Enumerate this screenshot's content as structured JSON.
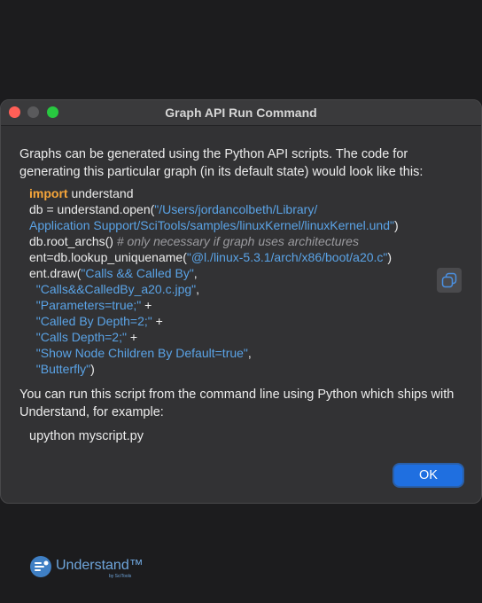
{
  "window": {
    "title": "Graph API Run Command"
  },
  "intro": "Graphs can be generated using the Python API scripts. The code for generating this particular graph (in its default state) would look like this:",
  "code": {
    "line1_kw": "import",
    "line1_rest": " understand",
    "line2_pre": "db = understand.open(",
    "line2_str": "\"/Users/jordancolbeth/Library/",
    "line3_str": "Application Support/SciTools/samples/linuxKernel/linuxKernel.und\"",
    "line3_post": ")",
    "line4_pre": "db.root_archs() ",
    "line4_comment": "# only necessary if graph uses architectures",
    "line5_pre": "ent=db.lookup_uniquename(",
    "line5_str": "\"@l./linux-5.3.1/arch/x86/boot/a20.c\"",
    "line5_post": ")",
    "line6_pre": "ent.draw(",
    "line6_str": "\"Calls && Called By\"",
    "line6_post": ",",
    "line7_str": "\"Calls&&CalledBy_a20.c.jpg\"",
    "line7_post": ",",
    "line8_str": "\"Parameters=true;\"",
    "line8_post": " +",
    "line9_str": "\"Called By Depth=2;\"",
    "line9_post": " +",
    "line10_str": "\"Calls Depth=2;\"",
    "line10_post": " +",
    "line11_str": "\"Show Node Children By Default=true\"",
    "line11_post": ",",
    "line12_str": "\"Butterfly\"",
    "line12_post": ")"
  },
  "outro": "You can run this script from the command line using Python which ships with Understand, for example:",
  "command": "upython myscript.py",
  "buttons": {
    "ok": "OK"
  },
  "brand": {
    "name": "Understand™",
    "sub": "by SciTools"
  },
  "icons": {
    "copy": "copy-icon",
    "logo": "understand-logo-icon"
  },
  "colors": {
    "accent": "#1f6fe0",
    "keyword": "#f7a63a",
    "string": "#5aa3e6",
    "comment": "#9b9b9f"
  }
}
